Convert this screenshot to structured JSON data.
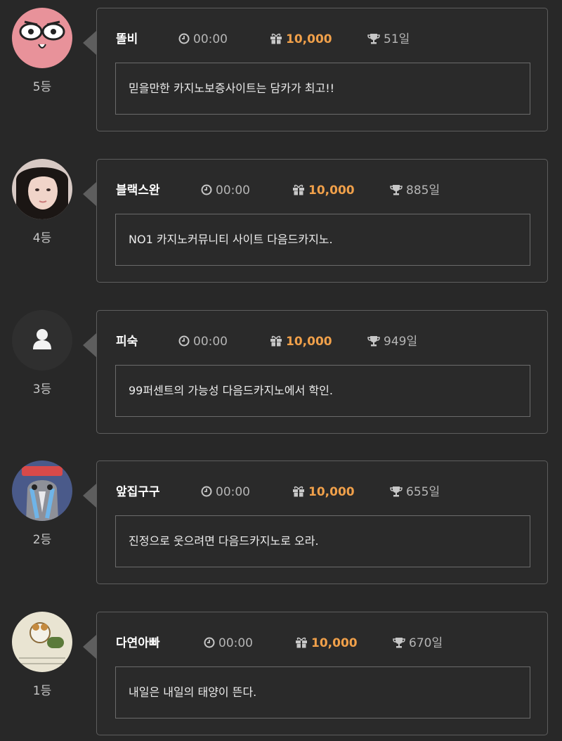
{
  "entries": [
    {
      "rank": "5등",
      "name": "똘비",
      "time": "00:00",
      "points": "10,000",
      "days": "51일",
      "message": "믿을만한 카지노보증사이트는 담카가 최고!!",
      "avatar": "pink-cartoon-face",
      "time_icon": "clock-icon",
      "points_icon": "gift-icon",
      "days_icon": "trophy-icon"
    },
    {
      "rank": "4등",
      "name": "블랙스완",
      "time": "00:00",
      "points": "10,000",
      "days": "885일",
      "message": "NO1 카지노커뮤니티 사이트 다음드카지노.",
      "avatar": "woman-portrait-photo",
      "time_icon": "clock-icon",
      "points_icon": "gift-icon",
      "days_icon": "trophy-icon"
    },
    {
      "rank": "3등",
      "name": "피숙",
      "time": "00:00",
      "points": "10,000",
      "days": "949일",
      "message": "99퍼센트의 가능성 다음드카지노에서 학인.",
      "avatar": "default-user-silhouette",
      "time_icon": "clock-icon",
      "points_icon": "gift-icon",
      "days_icon": "trophy-icon"
    },
    {
      "rank": "2등",
      "name": "앞집구구",
      "time": "00:00",
      "points": "10,000",
      "days": "655일",
      "message": "진정으로 웃으려면 다음드카지노로 오라.",
      "avatar": "crying-cartoon-character",
      "time_icon": "clock-icon",
      "points_icon": "gift-icon",
      "days_icon": "trophy-icon"
    },
    {
      "rank": "1등",
      "name": "다연아빠",
      "time": "00:00",
      "points": "10,000",
      "days": "670일",
      "message": "내일은 내일의 태양이 뜬다.",
      "avatar": "hamster-cartoon-image",
      "time_icon": "clock-icon",
      "points_icon": "gift-icon",
      "days_icon": "trophy-icon"
    }
  ],
  "colors": {
    "background": "#282828",
    "card_border": "#5e5e5e",
    "points": "#f0a04a",
    "name": "#ffffff",
    "meta": "#b5b5b5"
  }
}
